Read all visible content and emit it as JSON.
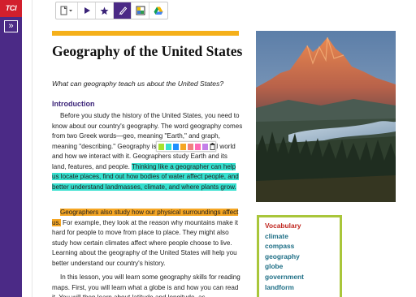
{
  "app": {
    "logo_text": "TCI"
  },
  "rail": {
    "expand_glyph": "»"
  },
  "toolbar": {
    "items": [
      {
        "icon": "notebook-dropdown-icon"
      },
      {
        "icon": "play-icon"
      },
      {
        "icon": "star-icon"
      },
      {
        "icon": "highlighter-icon",
        "active": true
      },
      {
        "icon": "image-icon"
      },
      {
        "icon": "google-drive-icon"
      }
    ]
  },
  "article": {
    "title": "Geography of the United States",
    "subtitle": "What can geography teach us about the United States?",
    "intro_heading": "Introduction",
    "p1_plain": "Before you study the history of the United States, you need to know about our country's geography. The word geography comes from two Greek words—geo, meaning \"Earth,\" and graph, meaning \"describing.\" Geography is the study of physical world and how we interact with it. Geographers study Earth and its land, features, and people. ",
    "p1_highlight": "Thinking like a geographer can help us locate places, find out how bodies of water affect people, and better understand landmasses, climate, and where plants grow.",
    "p2_highlight": "Geographers also study how our physical surroundings affect us.",
    "p2_plain": " For example, they look at the reason why mountains make it hard for people to move from place to place. They might also study how certain climates affect where people choose to live. Learning about the geography of the United States will help you better understand our country's history.",
    "p3_plain": "In this lesson, you will learn some geography skills for reading maps. First, you will learn what a globe is and how you can read it. You will then learn about latitude and longitude, as"
  },
  "highlight_palette": {
    "colors": [
      "#a6e22e",
      "#36e0cf",
      "#1e90ff",
      "#f5a623",
      "#f08080",
      "#ff69b4",
      "#c37fe8"
    ]
  },
  "vocabulary": {
    "title": "Vocabulary",
    "words": [
      "climate",
      "compass",
      "geography",
      "globe",
      "government",
      "landform"
    ]
  },
  "colors": {
    "rail": "#4b2a86",
    "logo": "#d21f2d",
    "accent_bar": "#f5b01a",
    "teal_highlight": "#36e0cf",
    "orange_highlight": "#f5a623",
    "vocab_border": "#a9c63a"
  }
}
